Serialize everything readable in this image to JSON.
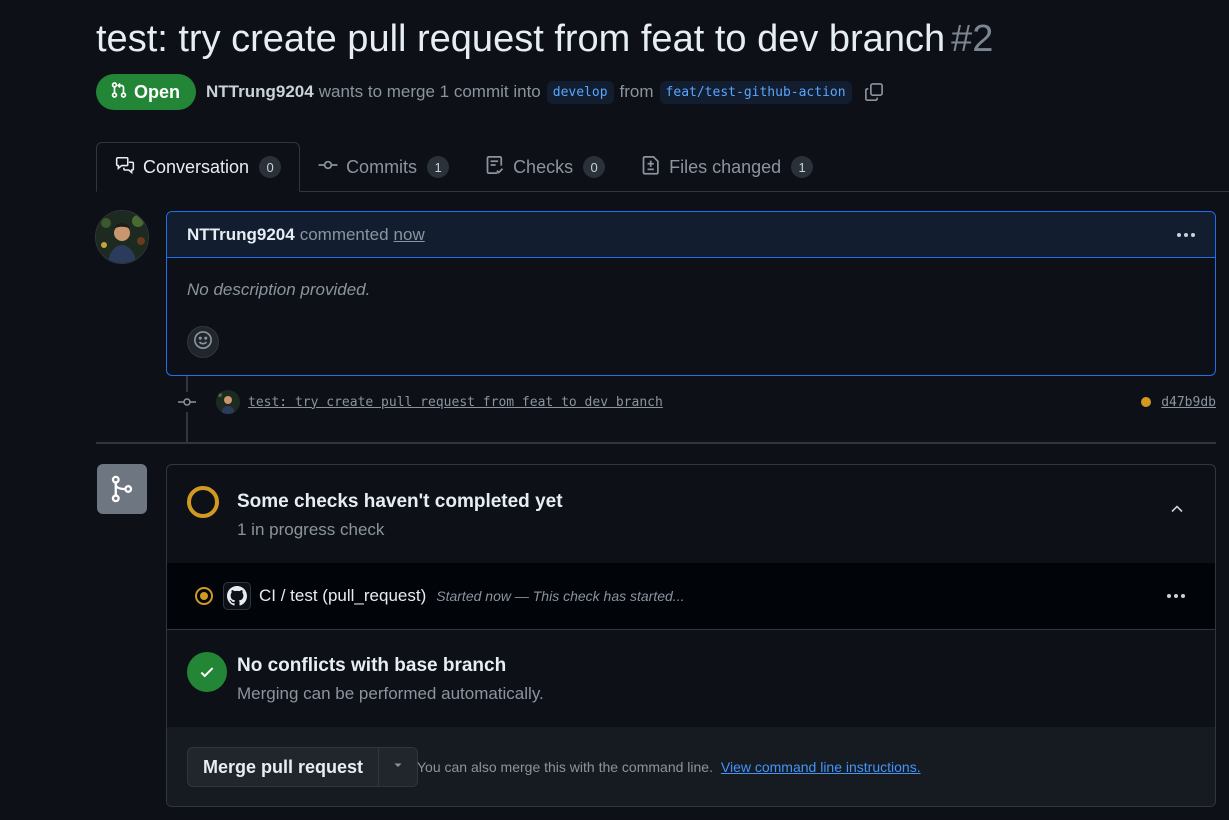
{
  "pr": {
    "title": "test: try create pull request from feat to dev branch",
    "number": "#2",
    "state": "Open",
    "author": "NTTrung9204",
    "merge_text": "wants to merge 1 commit into",
    "base_branch": "develop",
    "from_text": "from",
    "head_branch": "feat/test-github-action"
  },
  "tabs": [
    {
      "label": "Conversation",
      "count": "0",
      "icon": "comment-discussion-icon"
    },
    {
      "label": "Commits",
      "count": "1",
      "icon": "git-commit-icon"
    },
    {
      "label": "Checks",
      "count": "0",
      "icon": "checklist-icon"
    },
    {
      "label": "Files changed",
      "count": "1",
      "icon": "file-diff-icon"
    }
  ],
  "comment": {
    "author": "NTTrung9204",
    "action": "commented",
    "time": "now",
    "body": "No description provided."
  },
  "commit": {
    "message": "test: try create pull request from feat to dev branch",
    "sha": "d47b9db",
    "status_color": "#d29922"
  },
  "checks": {
    "title": "Some checks haven't completed yet",
    "subtitle": "1 in progress check",
    "items": [
      {
        "name": "CI / test (pull_request)",
        "description": "Started now — This check has started..."
      }
    ]
  },
  "conflicts": {
    "title": "No conflicts with base branch",
    "subtitle": "Merging can be performed automatically."
  },
  "merge": {
    "button_label": "Merge pull request",
    "hint": "You can also merge this with the command line.",
    "link": "View command line instructions."
  },
  "colors": {
    "open_green": "#238636",
    "pending_yellow": "#d29922",
    "link_blue": "#4493f8",
    "background": "#0d1117"
  }
}
